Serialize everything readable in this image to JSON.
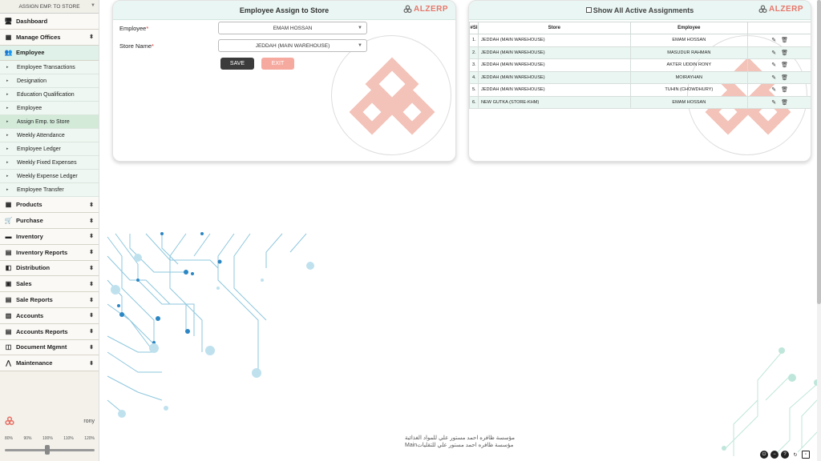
{
  "sidebar": {
    "top_select": "ASSIGN EMP. TO STORE",
    "menu_top": [
      {
        "label": "Dashboard",
        "icon": "monitor-icon"
      },
      {
        "label": "Manage Offices",
        "icon": "office-icon"
      },
      {
        "label": "Employee",
        "icon": "users-icon"
      }
    ],
    "sub_items": [
      "Employee Transactions",
      "Designation",
      "Education Qualification",
      "Employee",
      "Assign Emp. to Store",
      "Weekly Attendance",
      "Employee Ledger",
      "Weekly Fixed Expenses",
      "Weekly Expense Ledger",
      "Employee Transfer"
    ],
    "menu_bottom": [
      {
        "label": "Products",
        "icon": "grid-icon"
      },
      {
        "label": "Purchase",
        "icon": "cart-icon"
      },
      {
        "label": "Inventory",
        "icon": "box-icon"
      },
      {
        "label": "Inventory Reports",
        "icon": "report-icon"
      },
      {
        "label": "Distribution",
        "icon": "book-icon"
      },
      {
        "label": "Sales",
        "icon": "register-icon"
      },
      {
        "label": "Sale Reports",
        "icon": "chart-icon"
      },
      {
        "label": "Accounts",
        "icon": "wallet-icon"
      },
      {
        "label": "Accounts Reports",
        "icon": "ledger-icon"
      },
      {
        "label": "Document Mgmnt",
        "icon": "document-icon"
      },
      {
        "label": "Maintenance",
        "icon": "tool-icon"
      }
    ],
    "user": "rony",
    "zoom_labels": [
      "80%",
      "90%",
      "100%",
      "110%",
      "120%"
    ],
    "zoom_value": "100%"
  },
  "assign_panel": {
    "title": "Employee Assign to Store",
    "logo": "ALZERP",
    "employee_label": "Employee",
    "employee_value": "EMAM HOSSAN",
    "store_label": "Store Name",
    "store_value": "JEDDAH (MAIN WAREHOUSE)",
    "save_label": "SAVE",
    "exit_label": "EXIT"
  },
  "list_panel": {
    "checkbox_label": "Show All Active Assignments",
    "logo": "ALZERP",
    "columns": [
      "#Sl",
      "Store",
      "Employee",
      ""
    ],
    "rows": [
      {
        "sl": "1.",
        "store": "JEDDAH (MAIN WAREHOUSE)",
        "employee": "EMAM HOSSAN"
      },
      {
        "sl": "2.",
        "store": "JEDDAH (MAIN WAREHOUSE)",
        "employee": "MASUDUR RAHMAN"
      },
      {
        "sl": "3.",
        "store": "JEDDAH (MAIN WAREHOUSE)",
        "employee": "AKTER UDDIN RONY"
      },
      {
        "sl": "4.",
        "store": "JEDDAH (MAIN WAREHOUSE)",
        "employee": "MOIRAYHAN"
      },
      {
        "sl": "5.",
        "store": "JEDDAH (MAIN WAREHOUSE)",
        "employee": "TUHIN (CHOWDHURY)"
      },
      {
        "sl": "6.",
        "store": "NEW GUTKA (STORE-KHM)",
        "employee": "EMAM HOSSAN"
      }
    ]
  },
  "footer": {
    "line1": "مؤسسة ظافره احمد مستور علي للمواد الغذائية",
    "line2": "Mainمؤسسة ظافره احمد مستور علي للتقليات"
  },
  "colors": {
    "accent": "#e8766a",
    "header_bg": "#e9f6f3",
    "row_alt": "#eaf6f1",
    "active": "#c0392b"
  }
}
